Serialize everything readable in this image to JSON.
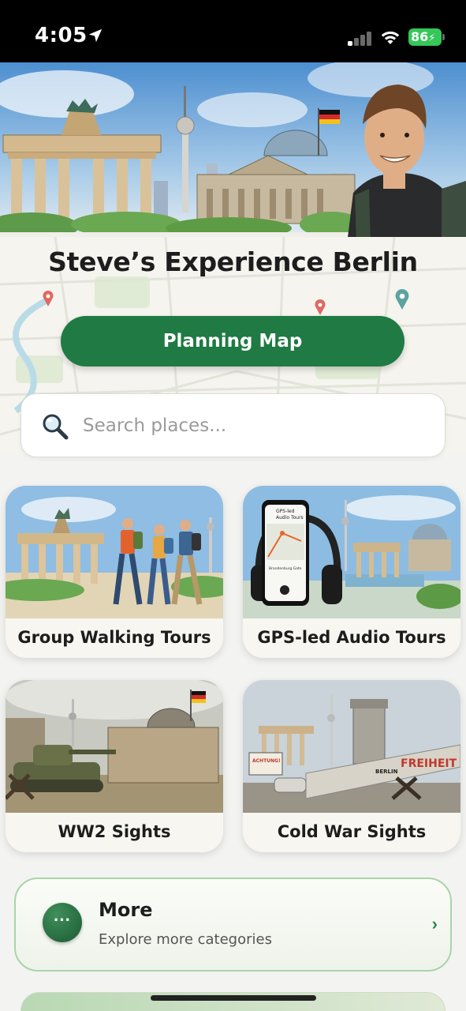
{
  "status_bar": {
    "time": "4:05",
    "battery": "86"
  },
  "header": {
    "title": "Steve’s Experience Berlin"
  },
  "planning_button": {
    "label": "Planning Map"
  },
  "search": {
    "placeholder": "Search places...",
    "value": ""
  },
  "categories": [
    {
      "label": "Group Walking Tours",
      "icon": "walking-group-illustration"
    },
    {
      "label": "GPS-led Audio Tours",
      "icon": "audio-tour-illustration"
    },
    {
      "label": "WW2 Sights",
      "icon": "ww2-illustration"
    },
    {
      "label": "Cold War Sights",
      "icon": "cold-war-illustration"
    }
  ],
  "audio_phone": {
    "app_title": "GPS-led\nAudio Tours",
    "stop": "Brandenburg Gate"
  },
  "coldwar_art": {
    "sign": "ACHTUNG!",
    "wall_text": "FREIHEIT",
    "wall_tag": "BERLIN"
  },
  "more": {
    "title": "More",
    "subtitle": "Explore more categories",
    "chevron": "›"
  },
  "colors": {
    "primary_green": "#1f7a43",
    "accent_border": "#a9d4ac",
    "battery_green": "#34c759"
  }
}
